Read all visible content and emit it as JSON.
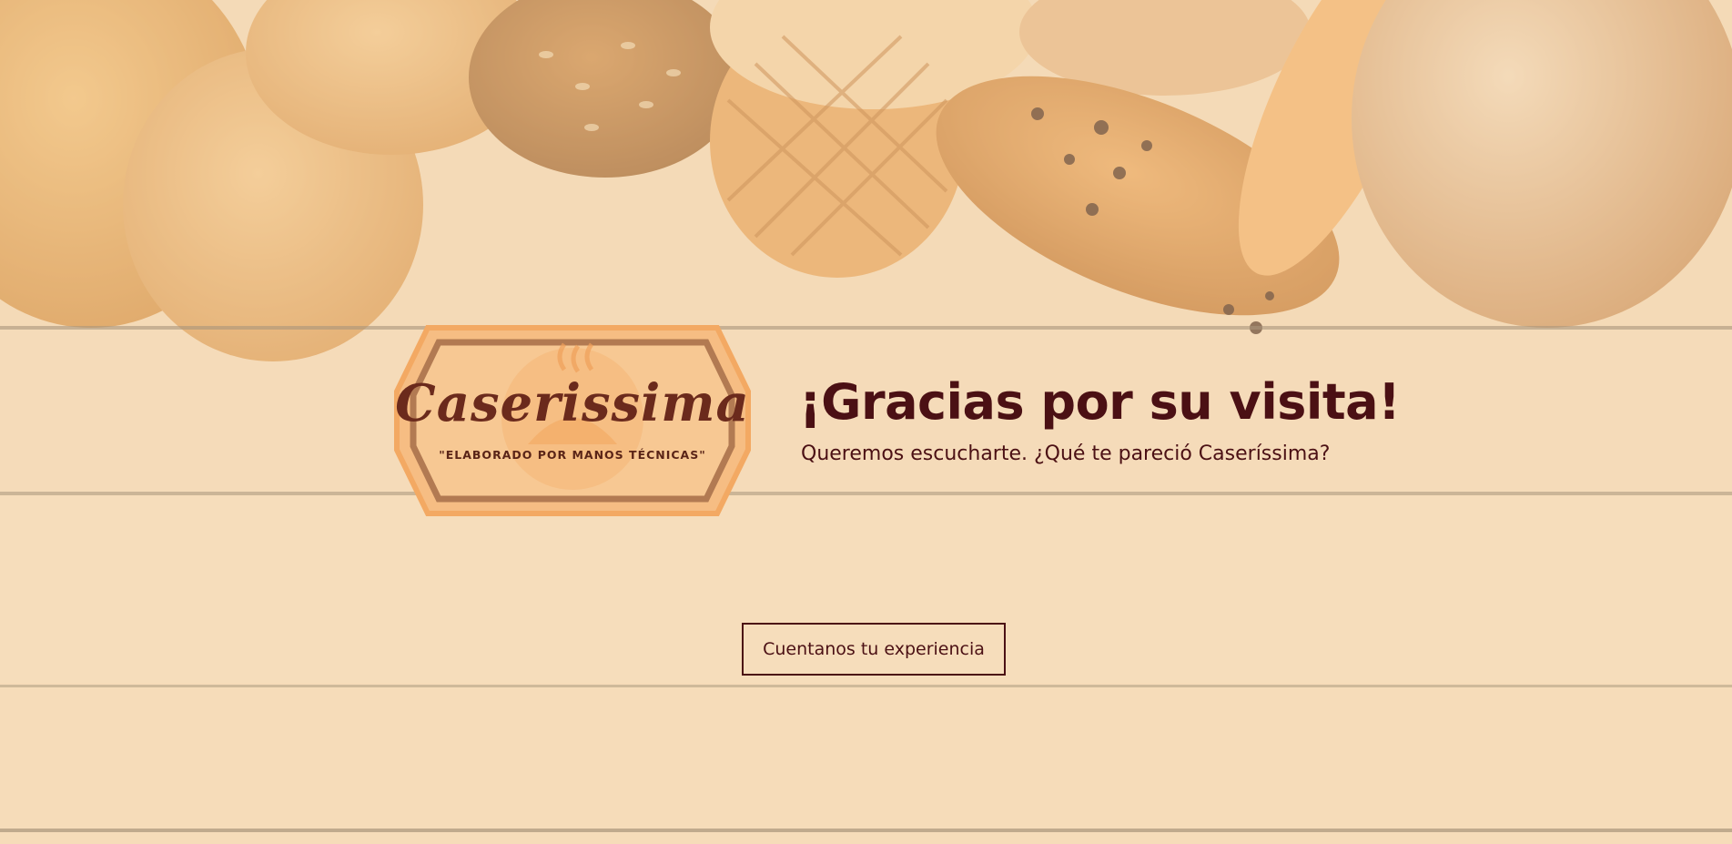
{
  "brand": {
    "name": "Caserissima",
    "tagline": "\"ELABORADO POR MANOS TÉCNICAS\""
  },
  "hero": {
    "title": "¡Gracias por su visita!",
    "subtitle": "Queremos escucharte. ¿Qué te pareció Caseríssima?",
    "cta_label": "Cuentanos tu experiencia"
  },
  "colors": {
    "text": "#4b1014",
    "background": "#f5dfc0",
    "logo_brown": "#6b2a1c",
    "logo_orange": "#f3b77a"
  }
}
